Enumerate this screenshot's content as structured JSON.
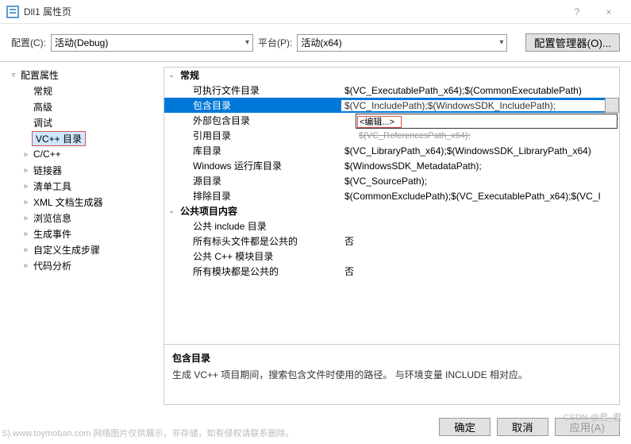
{
  "window": {
    "title": "Dll1 属性页",
    "help": "?",
    "close": "×"
  },
  "toolbar": {
    "config_label": "配置(C):",
    "config_value": "活动(Debug)",
    "platform_label": "平台(P):",
    "platform_value": "活动(x64)",
    "config_mgr": "配置管理器(O)..."
  },
  "tree": [
    {
      "label": "配置属性",
      "arrow": "▿",
      "level": 0
    },
    {
      "label": "常规",
      "arrow": "",
      "level": 1
    },
    {
      "label": "高级",
      "arrow": "",
      "level": 1
    },
    {
      "label": "调试",
      "arrow": "",
      "level": 1
    },
    {
      "label": "VC++ 目录",
      "arrow": "",
      "level": 1,
      "boxed": true,
      "selected": true
    },
    {
      "label": "C/C++",
      "arrow": "▹",
      "level": 1
    },
    {
      "label": "链接器",
      "arrow": "▹",
      "level": 1
    },
    {
      "label": "清单工具",
      "arrow": "▹",
      "level": 1
    },
    {
      "label": "XML 文档生成器",
      "arrow": "▹",
      "level": 1
    },
    {
      "label": "浏览信息",
      "arrow": "▹",
      "level": 1
    },
    {
      "label": "生成事件",
      "arrow": "▹",
      "level": 1
    },
    {
      "label": "自定义生成步骤",
      "arrow": "▹",
      "level": 1
    },
    {
      "label": "代码分析",
      "arrow": "▹",
      "level": 1
    }
  ],
  "grid": {
    "sections": [
      {
        "header": "常规",
        "rows": [
          {
            "label": "可执行文件目录",
            "value": "$(VC_ExecutablePath_x64);$(CommonExecutablePath)"
          },
          {
            "label": "包含目录",
            "value": "$(VC_IncludePath);$(WindowsSDK_IncludePath);",
            "selected": true,
            "dropdown": true
          },
          {
            "label": "外部包含目录",
            "value": ""
          },
          {
            "label": "引用目录",
            "value": "$(VC_ReferencesPath_x64);",
            "strike": true
          },
          {
            "label": "库目录",
            "value": "$(VC_LibraryPath_x64);$(WindowsSDK_LibraryPath_x64)"
          },
          {
            "label": "Windows 运行库目录",
            "value": "$(WindowsSDK_MetadataPath);"
          },
          {
            "label": "源目录",
            "value": "$(VC_SourcePath);"
          },
          {
            "label": "排除目录",
            "value": "$(CommonExcludePath);$(VC_ExecutablePath_x64);$(VC_I"
          }
        ]
      },
      {
        "header": "公共项目内容",
        "rows": [
          {
            "label": "公共 include 目录",
            "value": ""
          },
          {
            "label": "所有标头文件都是公共的",
            "value": "否"
          },
          {
            "label": "公共 C++ 模块目录",
            "value": ""
          },
          {
            "label": "所有模块都是公共的",
            "value": "否"
          }
        ]
      }
    ],
    "edit_value": "<编辑...>"
  },
  "description": {
    "title": "包含目录",
    "text": "生成 VC++ 项目期间，搜索包含文件时使用的路径。   与环境变量 INCLUDE 相对应。"
  },
  "footer": {
    "ok": "确定",
    "cancel": "取消",
    "apply": "应用(A)"
  },
  "watermark": "S).www.toymoban.com 网络图片仅供展示，非存储，如有侵权请联系删除。",
  "watermark2": "CSDN @君_君"
}
